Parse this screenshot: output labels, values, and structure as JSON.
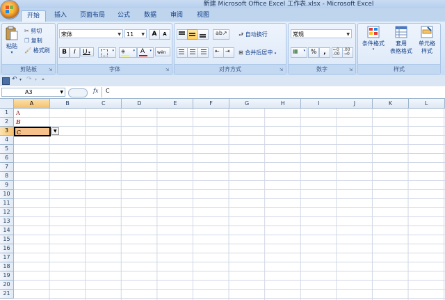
{
  "window": {
    "title": "新建 Microsoft Office Excel 工作表.xlsx - Microsoft Excel"
  },
  "tabs": [
    {
      "label": "开始",
      "active": true
    },
    {
      "label": "插入"
    },
    {
      "label": "页面布局"
    },
    {
      "label": "公式"
    },
    {
      "label": "数据"
    },
    {
      "label": "审阅"
    },
    {
      "label": "视图"
    }
  ],
  "ribbon": {
    "clipboard": {
      "label": "剪贴板",
      "paste": "粘贴",
      "cut": "剪切",
      "copy": "复制",
      "format_painter": "格式刷"
    },
    "font": {
      "label": "字体",
      "font_name": "宋体",
      "font_size": "11",
      "bold": "B",
      "italic": "I",
      "underline": "U",
      "grow": "A",
      "shrink": "A",
      "font_color": "A",
      "phonetic": "wén"
    },
    "alignment": {
      "label": "对齐方式",
      "wrap_text": "自动换行",
      "merge_center": "合并后居中"
    },
    "number": {
      "label": "数字",
      "format": "常规",
      "percent": "%",
      "comma": ",",
      "inc_decimal": "+.0\n.00",
      "dec_decimal": ".00\n→.0"
    },
    "styles": {
      "label": "样式",
      "conditional": "条件格式",
      "table_format_1": "套用",
      "table_format_2": "表格格式",
      "cell_styles_1": "单元格",
      "cell_styles_2": "样式"
    }
  },
  "formula_bar": {
    "name_box": "A3",
    "fx": "fx",
    "content": "C"
  },
  "sheet": {
    "columns": [
      "A",
      "B",
      "C",
      "D",
      "E",
      "F",
      "G",
      "H",
      "I",
      "J",
      "K",
      "L"
    ],
    "rows": [
      "1",
      "2",
      "3",
      "4",
      "5",
      "6",
      "7",
      "8",
      "9",
      "10",
      "11",
      "12",
      "13",
      "14",
      "15",
      "16",
      "17",
      "18",
      "19",
      "20",
      "21"
    ],
    "selected_column": "A",
    "selected_row": "3",
    "cells": [
      {
        "ref": "A1",
        "value": "A"
      },
      {
        "ref": "A2",
        "value": "B"
      },
      {
        "ref": "A3",
        "value": "C"
      }
    ]
  },
  "colors": {
    "accent": "#15428b",
    "selection": "#f6c16e",
    "cell_a1": "#8b1a1a",
    "cell_a2": "#c0392b"
  }
}
